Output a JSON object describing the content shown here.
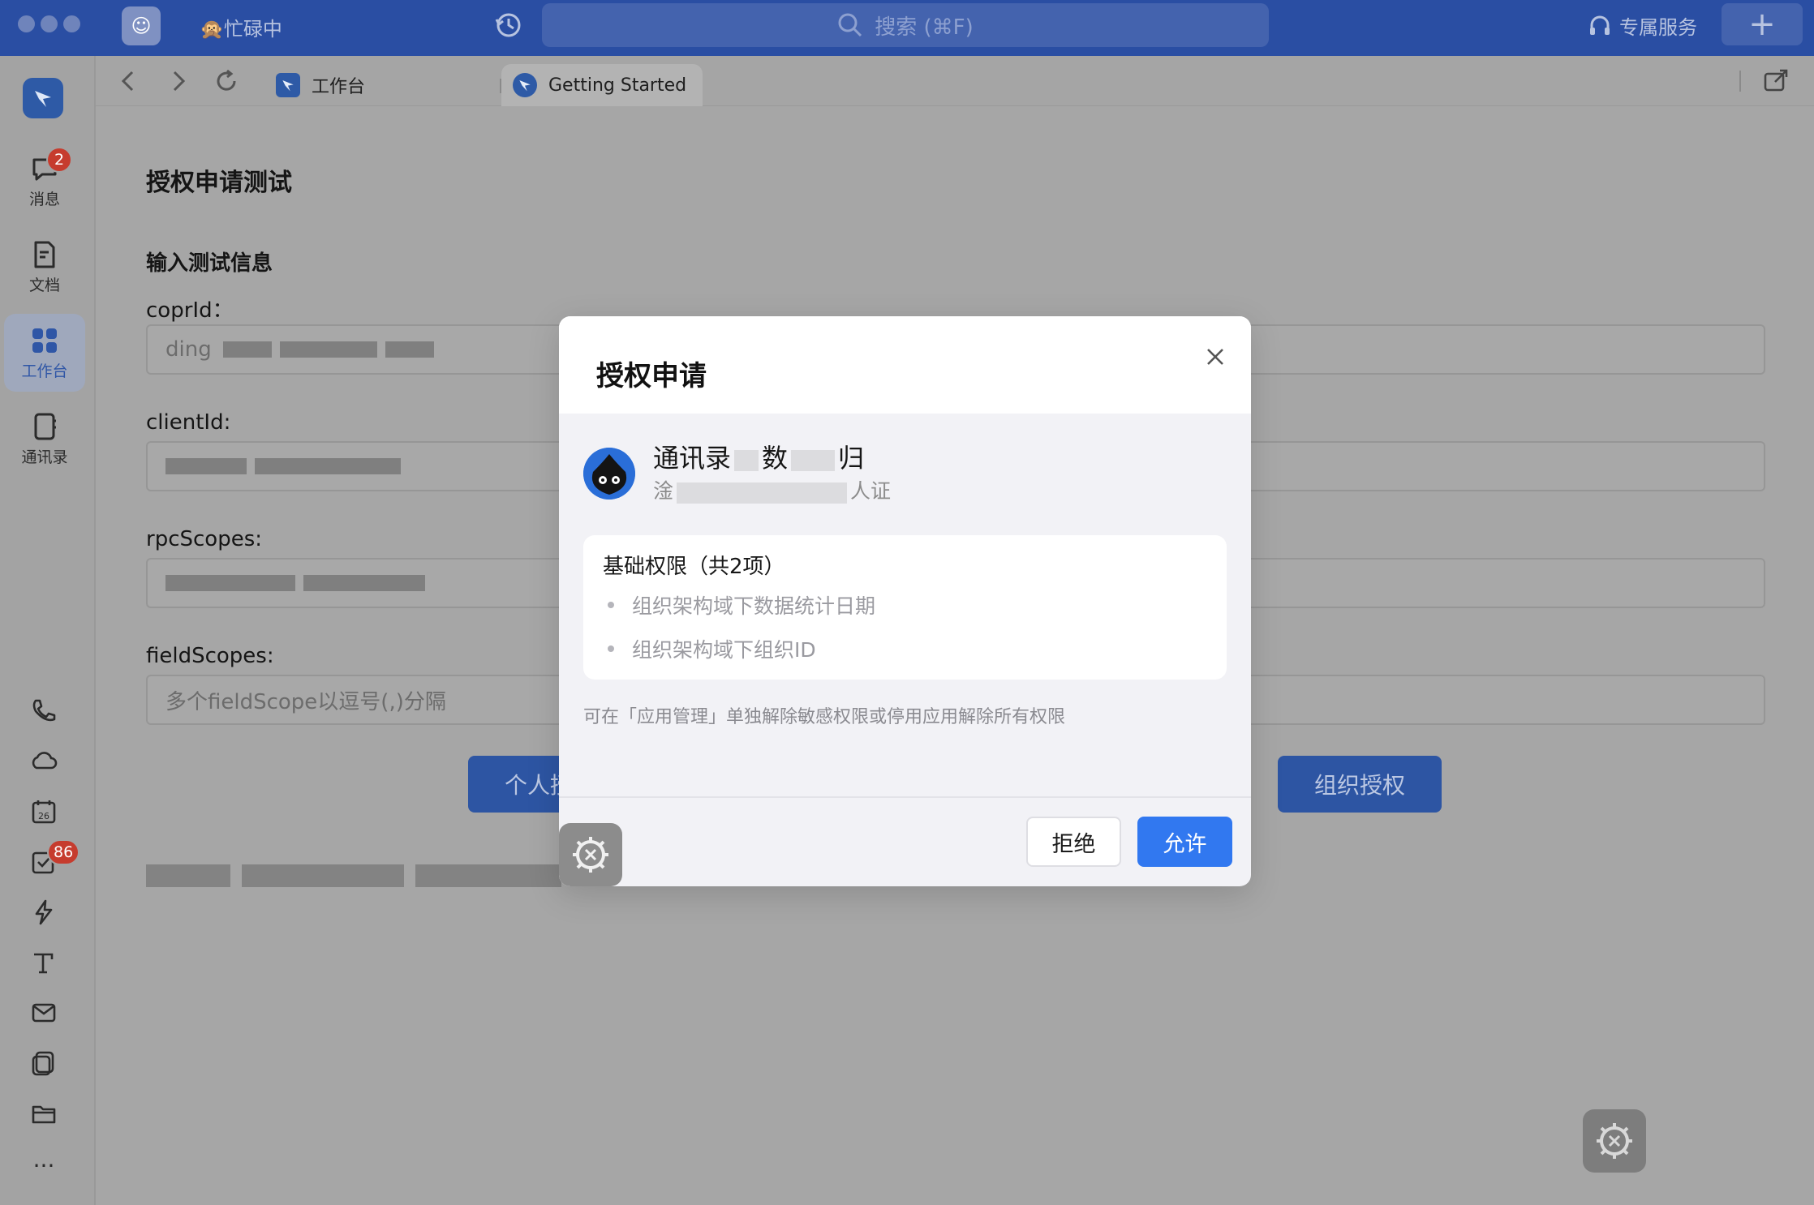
{
  "titlebar": {
    "status_text": "忙碌中",
    "search_placeholder": "搜索 (⌘F)",
    "service_label": "专属服务",
    "plus_label": "+"
  },
  "sidebar": {
    "items": [
      {
        "label": "消息",
        "badge": "2"
      },
      {
        "label": "文档"
      },
      {
        "label": "工作台"
      },
      {
        "label": "通讯录"
      }
    ],
    "todo_badge": "86",
    "calendar_day": "26",
    "more_label": "···"
  },
  "tabs": {
    "workbench_label": "工作台",
    "active_label": "Getting Started"
  },
  "page": {
    "title": "授权申请测试",
    "section_title": "输入测试信息",
    "corp_label": "coprId：",
    "corp_value_visible": "ding",
    "client_label": "clientId:",
    "rpc_label": "rpcScopes:",
    "field_label": "fieldScopes:",
    "field_placeholder": "多个fieldScope以逗号(,)分隔",
    "personal_btn": "个人授权",
    "org_btn": "组织授权"
  },
  "modal": {
    "title": "授权申请",
    "app_name_parts": [
      "通讯录",
      "数",
      "归"
    ],
    "app_desc_parts": [
      "淦",
      "人证"
    ],
    "perm_title": "基础权限（共2项）",
    "permissions": [
      "组织架构域下数据统计日期",
      "组织架构域下组织ID"
    ],
    "hint": "可在「应用管理」单独解除敏感权限或停用应用解除所有权限",
    "reject_label": "拒绝",
    "allow_label": "允许"
  },
  "colors": {
    "brand": "#2a4ea3",
    "allow": "#3178f0",
    "badge": "#c63c2e"
  }
}
